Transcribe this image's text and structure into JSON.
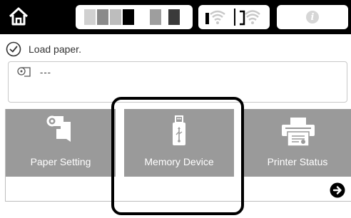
{
  "topbar": {
    "home_icon": "home-icon",
    "ink_colors": [
      "#d0d0d0",
      "#8a8a8a",
      "#bdbdbd",
      "#000000",
      "#9e9e9e",
      "#3a3a3a"
    ],
    "wired_icon": "wired-lan-icon",
    "wifi_icon": "wifi-icon",
    "info_icon": "info-icon",
    "info_glyph": "i"
  },
  "status": {
    "icon": "check-circle-icon",
    "message": "Load paper."
  },
  "paper": {
    "icon": "roll-paper-icon",
    "value": "---"
  },
  "tiles": [
    {
      "label": "Paper Setting",
      "icon": "paper-setting-icon"
    },
    {
      "label": "Memory Device",
      "icon": "usb-memory-icon"
    },
    {
      "label": "Printer Status",
      "icon": "printer-status-icon"
    }
  ],
  "nav": {
    "next_icon": "arrow-right-circle-icon"
  },
  "colors": {
    "topbar": "#000000",
    "tile": "#9a9a9a",
    "highlight": "#000000"
  }
}
